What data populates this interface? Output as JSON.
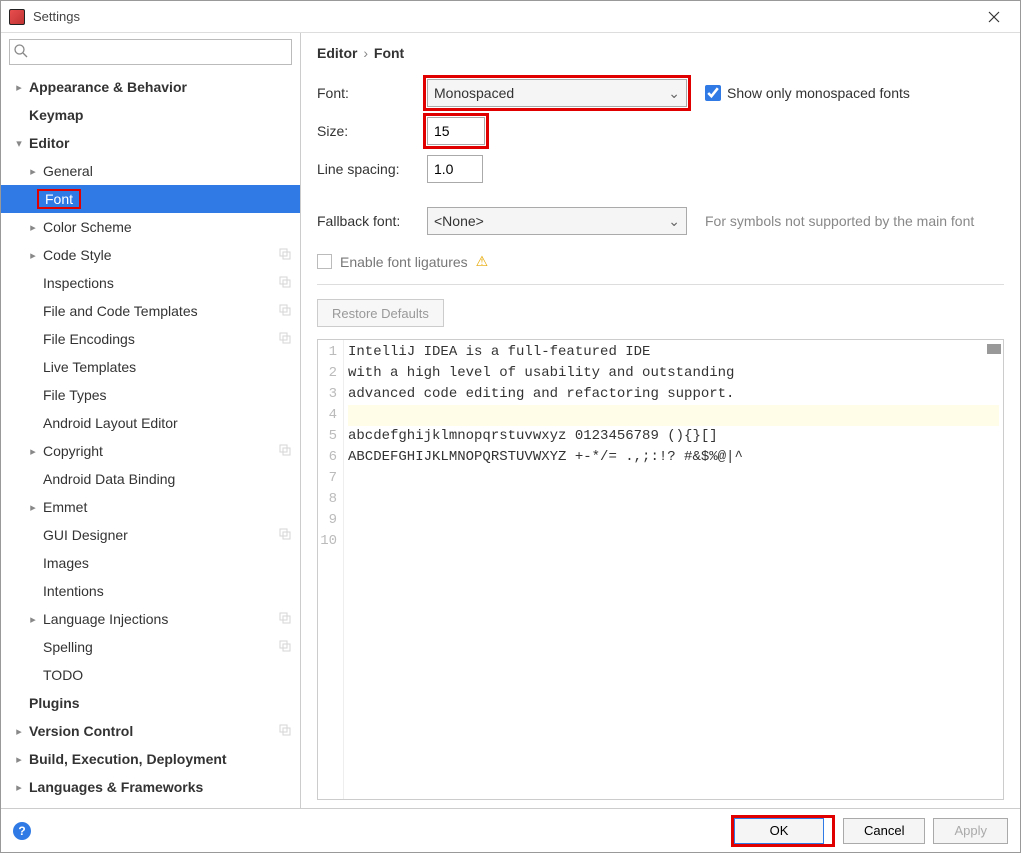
{
  "window": {
    "title": "Settings"
  },
  "search": {
    "placeholder": ""
  },
  "tree": {
    "items": [
      {
        "label": "Appearance & Behavior",
        "indent": 0,
        "bold": true,
        "expand": "collapsed"
      },
      {
        "label": "Keymap",
        "indent": 0,
        "bold": true
      },
      {
        "label": "Editor",
        "indent": 0,
        "bold": true,
        "expand": "expanded"
      },
      {
        "label": "General",
        "indent": 1,
        "expand": "collapsed"
      },
      {
        "label": "Font",
        "indent": 1,
        "selected": true,
        "highlight": true
      },
      {
        "label": "Color Scheme",
        "indent": 1,
        "expand": "collapsed"
      },
      {
        "label": "Code Style",
        "indent": 1,
        "expand": "collapsed",
        "dup": true
      },
      {
        "label": "Inspections",
        "indent": 1,
        "dup": true
      },
      {
        "label": "File and Code Templates",
        "indent": 1,
        "dup": true
      },
      {
        "label": "File Encodings",
        "indent": 1,
        "dup": true
      },
      {
        "label": "Live Templates",
        "indent": 1
      },
      {
        "label": "File Types",
        "indent": 1
      },
      {
        "label": "Android Layout Editor",
        "indent": 1
      },
      {
        "label": "Copyright",
        "indent": 1,
        "expand": "collapsed",
        "dup": true
      },
      {
        "label": "Android Data Binding",
        "indent": 1
      },
      {
        "label": "Emmet",
        "indent": 1,
        "expand": "collapsed"
      },
      {
        "label": "GUI Designer",
        "indent": 1,
        "dup": true
      },
      {
        "label": "Images",
        "indent": 1
      },
      {
        "label": "Intentions",
        "indent": 1
      },
      {
        "label": "Language Injections",
        "indent": 1,
        "expand": "collapsed",
        "dup": true
      },
      {
        "label": "Spelling",
        "indent": 1,
        "dup": true
      },
      {
        "label": "TODO",
        "indent": 1
      },
      {
        "label": "Plugins",
        "indent": 0,
        "bold": true
      },
      {
        "label": "Version Control",
        "indent": 0,
        "bold": true,
        "expand": "collapsed",
        "dup": true
      },
      {
        "label": "Build, Execution, Deployment",
        "indent": 0,
        "bold": true,
        "expand": "collapsed"
      },
      {
        "label": "Languages & Frameworks",
        "indent": 0,
        "bold": true,
        "expand": "collapsed"
      }
    ]
  },
  "breadcrumb": {
    "parent": "Editor",
    "child": "Font"
  },
  "form": {
    "font_label": "Font:",
    "font_value": "Monospaced",
    "mono_label": "Show only monospaced fonts",
    "size_label": "Size:",
    "size_value": "15",
    "ls_label": "Line spacing:",
    "ls_value": "1.0",
    "fallback_label": "Fallback font:",
    "fallback_value": "<None>",
    "fallback_hint": "For symbols not supported by the main font",
    "liga_label": "Enable font ligatures",
    "restore_label": "Restore Defaults"
  },
  "preview": {
    "lines": [
      "IntelliJ IDEA is a full-featured IDE",
      "with a high level of usability and outstanding",
      "advanced code editing and refactoring support.",
      "",
      "abcdefghijklmnopqrstuvwxyz 0123456789 (){}[]",
      "ABCDEFGHIJKLMNOPQRSTUVWXYZ +-*/= .,;:!? #&$%@|^",
      "",
      "",
      "",
      ""
    ],
    "current_line": 4
  },
  "footer": {
    "ok": "OK",
    "cancel": "Cancel",
    "apply": "Apply"
  }
}
